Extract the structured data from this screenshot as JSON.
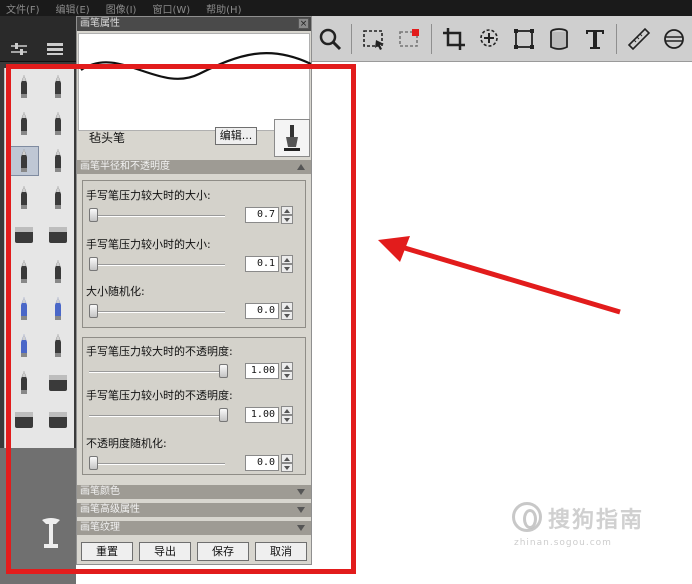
{
  "menu": [
    "文件(F)",
    "编辑(E)",
    "图像(I)",
    "窗口(W)",
    "帮助(H)"
  ],
  "panel": {
    "title": "画笔属性",
    "brush_name": "毡头笔",
    "edit_label": "编辑...",
    "sections": {
      "radius_opacity": "画笔半径和不透明度",
      "color": "画笔颜色",
      "advanced": "画笔高级属性",
      "texture": "画笔纹理"
    },
    "controls": [
      {
        "label": "手写笔压力较大时的大小:",
        "value": "0.7",
        "level": 0.0
      },
      {
        "label": "手写笔压力较小时的大小:",
        "value": "0.1",
        "level": 0.0
      },
      {
        "label": "大小随机化:",
        "value": "0.0",
        "level": 0.0
      },
      {
        "label": "手写笔压力较大时的不透明度:",
        "value": "1.00",
        "level": 1.0
      },
      {
        "label": "手写笔压力较小时的不透明度:",
        "value": "1.00",
        "level": 1.0
      },
      {
        "label": "不透明度随机化:",
        "value": "0.0",
        "level": 0.0
      }
    ],
    "buttons": {
      "reset": "重置",
      "export": "导出",
      "save": "保存",
      "cancel": "取消"
    }
  },
  "toolbar_icons": [
    "magnifier-icon",
    "selection-icon",
    "transform-icon",
    "crop-icon",
    "lasso-icon",
    "distort-icon",
    "fill-icon",
    "text-icon",
    "ruler-icon",
    "ellipse-guide-icon"
  ],
  "watermark": {
    "text": "搜狗指南",
    "url": "zhinan.sogou.com"
  },
  "colors": {
    "annotation_red": "#e21c1c",
    "selected_brush": "#bfc7d4"
  }
}
